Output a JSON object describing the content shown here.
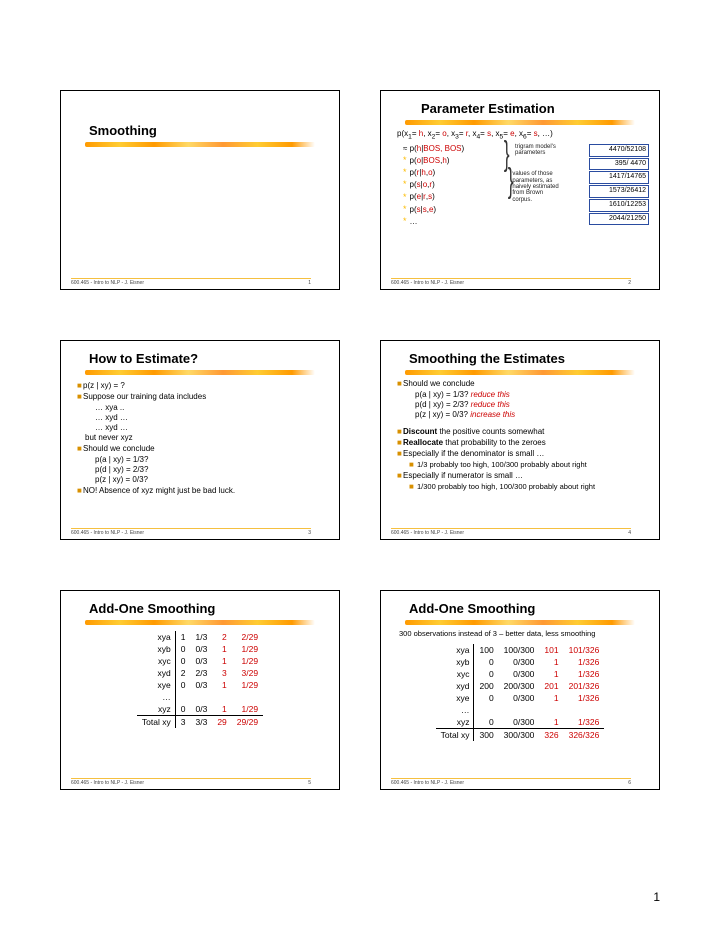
{
  "course_footer": "600.465 - Intro to NLP - J. Eisner",
  "page_number": "1",
  "slide1": {
    "title": "Smoothing",
    "num": "1"
  },
  "slide2": {
    "title": "Parameter Estimation",
    "joint": "p(x₁= h, x₂= o, x₃= r, x₄= s, x₅= e, x₆= s, …)",
    "rows": [
      {
        "lhs": "≈ p( h | BOS, BOS)",
        "box": "4470/52108"
      },
      {
        "lhs": "* p( o | BOS, h)",
        "box": "395/  4470"
      },
      {
        "lhs": "* p( r | h, o)",
        "box": "1417/14765"
      },
      {
        "lhs": "* p( s | o, r)",
        "box": "1573/26412"
      },
      {
        "lhs": "* p( e | r, s)",
        "box": "1610/12253"
      },
      {
        "lhs": "* p( s | s, e)",
        "box": "2044/21250"
      },
      {
        "lhs": "* …",
        "box": ""
      }
    ],
    "note_brace_top": "trigram model's parameters",
    "note_brace_bottom": "values of those parameters, as naively estimated from Brown corpus.",
    "num": "2"
  },
  "slide3": {
    "title": "How to Estimate?",
    "l1": "p(z | xy) = ?",
    "l2": "Suppose our training data includes",
    "seq": [
      "… xya ..",
      "… xyd …",
      "… xyd …"
    ],
    "l3": "but never xyz",
    "l4": "Should we conclude",
    "probs": [
      "p(a | xy) = 1/3?",
      "p(d | xy) = 2/3?",
      "p(z | xy) = 0/3?"
    ],
    "l5": "NO!  Absence of xyz might just be bad luck.",
    "num": "3"
  },
  "slide4": {
    "title": "Smoothing the Estimates",
    "l1": "Should we conclude",
    "probs": [
      {
        "t": "p(a | xy) = 1/3?",
        "n": "reduce this"
      },
      {
        "t": "p(d | xy) = 2/3?",
        "n": "reduce this"
      },
      {
        "t": "p(z | xy) = 0/3?",
        "n": "increase this"
      }
    ],
    "b1": "Discount",
    "b1t": " the positive counts somewhat",
    "b2": "Reallocate",
    "b2t": " that probability to the zeroes",
    "b3": "Especially if the denominator is small …",
    "b3s": "1/3 probably too high, 100/300 probably about right",
    "b4": "Especially if numerator is small …",
    "b4s": "1/300 probably too high, 100/300 probably about right",
    "num": "4"
  },
  "slide5": {
    "title": "Add-One Smoothing",
    "rows": [
      {
        "l": "xya",
        "a": "1",
        "b": "1/3",
        "c": "2",
        "d": "2/29"
      },
      {
        "l": "xyb",
        "a": "0",
        "b": "0/3",
        "c": "1",
        "d": "1/29"
      },
      {
        "l": "xyc",
        "a": "0",
        "b": "0/3",
        "c": "1",
        "d": "1/29"
      },
      {
        "l": "xyd",
        "a": "2",
        "b": "2/3",
        "c": "3",
        "d": "3/29"
      },
      {
        "l": "xye",
        "a": "0",
        "b": "0/3",
        "c": "1",
        "d": "1/29"
      },
      {
        "l": "…",
        "a": "",
        "b": "",
        "c": "",
        "d": ""
      },
      {
        "l": "xyz",
        "a": "0",
        "b": "0/3",
        "c": "1",
        "d": "1/29"
      }
    ],
    "total": {
      "l": "Total xy",
      "a": "3",
      "b": "3/3",
      "c": "29",
      "d": "29/29"
    },
    "num": "5"
  },
  "slide6": {
    "title": "Add-One Smoothing",
    "sub": "300 observations instead of 3 – better data, less smoothing",
    "rows": [
      {
        "l": "xya",
        "a": "100",
        "b": "100/300",
        "c": "101",
        "d": "101/326"
      },
      {
        "l": "xyb",
        "a": "0",
        "b": "0/300",
        "c": "1",
        "d": "1/326"
      },
      {
        "l": "xyc",
        "a": "0",
        "b": "0/300",
        "c": "1",
        "d": "1/326"
      },
      {
        "l": "xyd",
        "a": "200",
        "b": "200/300",
        "c": "201",
        "d": "201/326"
      },
      {
        "l": "xye",
        "a": "0",
        "b": "0/300",
        "c": "1",
        "d": "1/326"
      },
      {
        "l": "…",
        "a": "",
        "b": "",
        "c": "",
        "d": ""
      },
      {
        "l": "xyz",
        "a": "0",
        "b": "0/300",
        "c": "1",
        "d": "1/326"
      }
    ],
    "total": {
      "l": "Total xy",
      "a": "300",
      "b": "300/300",
      "c": "326",
      "d": "326/326"
    },
    "num": "6"
  }
}
